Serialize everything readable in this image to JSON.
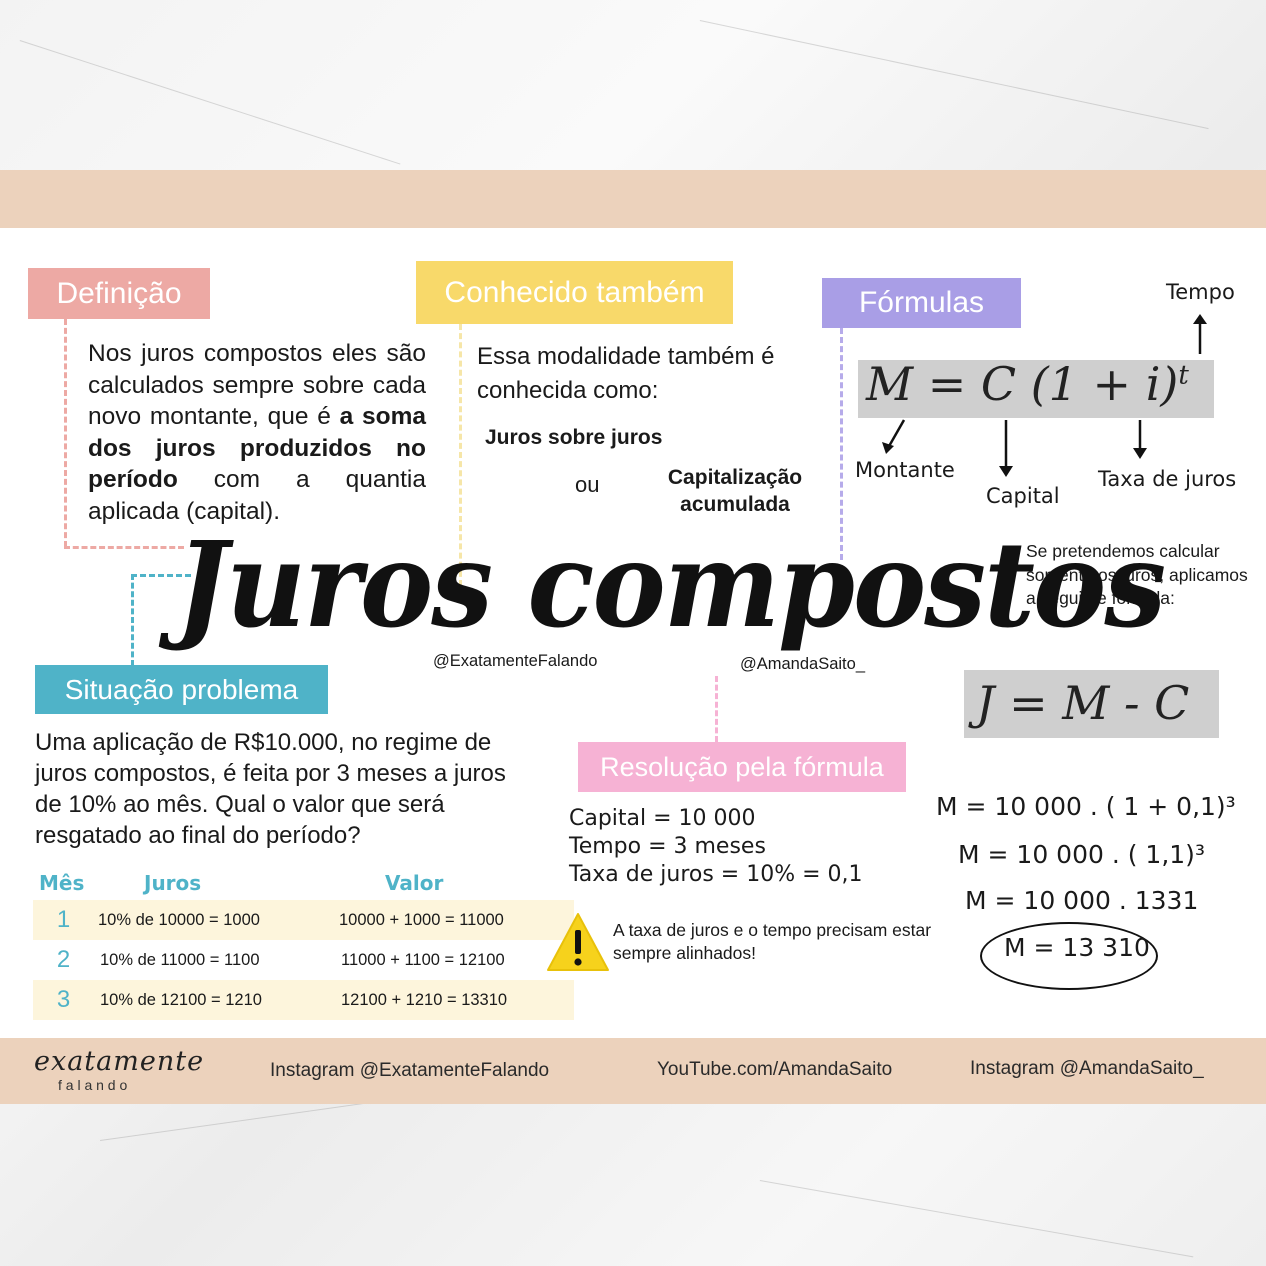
{
  "title": "Juros compostos",
  "credits": {
    "left": "@ExatamenteFalando",
    "right": "@AmandaSaito_"
  },
  "definicao": {
    "heading": "Definição",
    "text_1": "Nos juros compostos eles são calculados sempre sobre cada novo montante, que é",
    "text_bold": "a soma dos juros produzidos no período",
    "text_2": "com a quantia aplicada (capital)."
  },
  "conhecido": {
    "heading": "Conhecido também",
    "intro": "Essa modalidade também é conhecida como:",
    "alt_1": "Juros sobre juros",
    "or": "ou",
    "alt_2_line1": "Capitalização",
    "alt_2_line2": "acumulada"
  },
  "formulas": {
    "heading": "Fórmulas",
    "main_formula": "M = C (1 + i)",
    "exponent": "t",
    "label_tempo": "Tempo",
    "label_montante": "Montante",
    "label_capital": "Capital",
    "label_taxa": "Taxa de juros",
    "juros_note": "Se pretendemos calcular somente os juros, aplicamos a seguinte fórmula:",
    "juros_formula": "J = M - C"
  },
  "situacao": {
    "heading": "Situação problema",
    "text": "Uma aplicação de R$10.000, no regime de juros compostos, é feita por 3 meses a juros de 10% ao mês. Qual o valor que será resgatado ao final do período?",
    "table": {
      "headers": [
        "Mês",
        "Juros",
        "Valor"
      ],
      "rows": [
        [
          "1",
          "10% de 10000 = 1000",
          "10000 + 1000 = 11000"
        ],
        [
          "2",
          "10% de 11000 = 1100",
          "11000 + 1100 = 12100"
        ],
        [
          "3",
          "10% de 12100 = 1210",
          "12100 + 1210 = 13310"
        ]
      ]
    }
  },
  "resolucao": {
    "heading": "Resolução pela fórmula",
    "capital": "Capital = 10 000",
    "tempo": "Tempo = 3 meses",
    "taxa": "Taxa de juros = 10% = 0,1",
    "warning": "A taxa de juros e o tempo precisam estar sempre alinhados!",
    "step_1": "M = 10 000 . ( 1 + 0,1)³",
    "step_2": "M = 10 000 . ( 1,1)³",
    "step_3": "M = 10 000 . 1331",
    "result": "M = 13 310"
  },
  "footer": {
    "logo_top": "exatamente",
    "logo_bottom": "f a l a n d o",
    "link_1": "Instagram @ExatamenteFalando",
    "link_2": "YouTube.com/AmandaSaito",
    "link_3": "Instagram @AmandaSaito_"
  },
  "colors": {
    "band": "#ecd2bc",
    "definicao": "#eda9a4",
    "conhecido": "#f8d96a",
    "formulas": "#a99ee6",
    "situacao": "#4fb3c8",
    "resolucao": "#f6b2d4"
  }
}
